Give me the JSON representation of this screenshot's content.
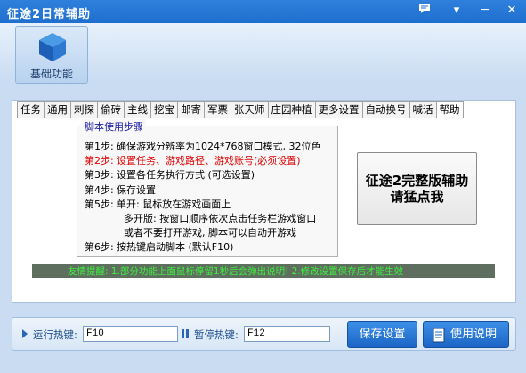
{
  "window": {
    "title": "征途2日常辅助"
  },
  "ribbon": {
    "module_label": "基础功能"
  },
  "tabs": [
    "任务",
    "通用",
    "刺探",
    "偷砖",
    "主线",
    "挖宝",
    "邮寄",
    "军票",
    "张天师",
    "庄园种植",
    "更多设置",
    "自动换号",
    "喊话",
    "帮助"
  ],
  "active_tab": "帮助",
  "steps": {
    "legend": "脚本使用步骤",
    "items": [
      {
        "num": "第1步:",
        "text": "确保游戏分辨率为1024*768窗口模式, 32位色"
      },
      {
        "num": "第2步:",
        "text": "设置任务、游戏路径、游戏账号(必须设置)"
      },
      {
        "num": "第3步:",
        "text": "设置各任务执行方式 (可选设置)"
      },
      {
        "num": "第4步:",
        "text": "保存设置"
      },
      {
        "num": "第5步:",
        "text": "单开: 鼠标放在游戏画面上"
      },
      {
        "num": "",
        "text": "多开版: 按窗口顺序依次点击任务栏游戏窗口"
      },
      {
        "num": "",
        "text": "或者不要打开游戏, 脚本可以自动开游戏"
      },
      {
        "num": "第6步:",
        "text": "按热键启动脚本 (默认F10)"
      }
    ]
  },
  "promo_button": {
    "line1": "征途2完整版辅助",
    "line2": "请猛点我"
  },
  "tip": "友情提醒: 1.部分功能上面鼠标停留1秒后会弹出说明! 2.修改设置保存后才能生效",
  "hotkeys": {
    "run_label": "运行热键:",
    "run_value": "F10",
    "pause_label": "暂停热键:",
    "pause_value": "F12"
  },
  "buttons": {
    "save": "保存设置",
    "help": "使用说明"
  },
  "colors": {
    "title_bar": "#1e6fcf",
    "tip_text": "#3df03d",
    "required_step": "#e00000"
  }
}
